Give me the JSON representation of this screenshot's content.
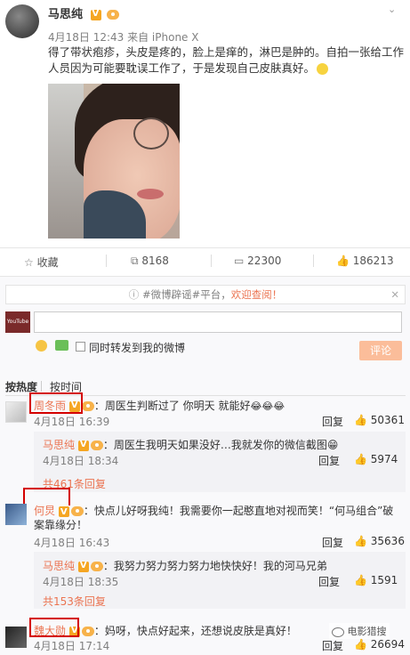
{
  "post": {
    "author": "马思纯",
    "meta": "4月18日 12:43 来自 iPhone X",
    "text": "得了带状疱疹，头皮是疼的，脸上是痒的，淋巴是肿的。自拍一张给工作人员因为可能要耽误工作了，于是发现自己皮肤真好。",
    "collect_label": "收藏",
    "repost_count": "8168",
    "comment_count": "22300",
    "like_count": "186213"
  },
  "notice": {
    "tag": "#微博辟谣#平台，",
    "link": "欢迎查阅！"
  },
  "composer": {
    "avatar_text": "YouTube",
    "repost_label": "同时转发到我的微博",
    "submit_label": "评论"
  },
  "sort": {
    "hot": "按热度",
    "time": "按时间"
  },
  "comments": [
    {
      "name": "周冬雨",
      "text": "：周医生判断过了 你明天 就能好",
      "emoji": "😂😂😂",
      "time": "4月18日 16:39",
      "reply_label": "回复",
      "likes": "50361",
      "reply": {
        "name": "马思纯",
        "text": "：周医生我明天如果没好…我就发你的微信截图",
        "emoji": "😁",
        "time": "4月18日 18:34",
        "reply_label": "回复",
        "likes": "5974"
      },
      "more": "共461条回复"
    },
    {
      "name": "何炅",
      "text": "：快点儿好呀我纯！我需要你一起憨直地对视而笑！“何马组合”破案靠缘分！",
      "time": "4月18日 16:43",
      "reply_label": "回复",
      "likes": "35636",
      "reply": {
        "name": "马思纯",
        "text": "：我努力努力努力努力地快快好！我的河马兄弟",
        "time": "4月18日 18:35",
        "reply_label": "回复",
        "likes": "1591"
      },
      "more": "共153条回复"
    },
    {
      "name": "魏大勋",
      "text": "：妈呀，快点好起来，还想说皮肤是真好！",
      "time": "4月18日 17:14",
      "reply_label": "回复",
      "likes": "26694"
    }
  ],
  "watermark": "电影猎搜"
}
